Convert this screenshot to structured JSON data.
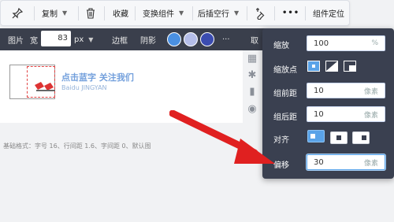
{
  "toolbar": {
    "copy_label": "复制",
    "favorite_label": "收藏",
    "transform_label": "变换组件",
    "insert_label": "后插空行",
    "more_label": "•••",
    "locate_label": "组件定位"
  },
  "image_bar": {
    "image_label": "图片",
    "width_label": "宽",
    "width_value": "83",
    "width_unit": "px",
    "border_label": "边框",
    "shadow_label": "阴影",
    "more_label": "···",
    "cancel_label": "取",
    "colors": [
      "#4a90e2",
      "#b4bde8",
      "#3b4cb0"
    ]
  },
  "canvas": {
    "watermark_line1": "点击蓝字 关注我们",
    "watermark_line2": "Baidu JINGYAN",
    "caption": "基础格式：字号 16、行间距 1.6、字间距 0、默认图"
  },
  "panel": {
    "scale_label": "缩放",
    "scale_value": "100",
    "scale_unit": "%",
    "anchor_label": "缩放点",
    "margin_top_label": "组前距",
    "margin_top_value": "10",
    "margin_top_unit": "像素",
    "margin_bottom_label": "组后距",
    "margin_bottom_value": "10",
    "margin_bottom_unit": "像素",
    "align_label": "对齐",
    "offset_label": "偏移",
    "offset_value": "30",
    "offset_unit": "像素"
  },
  "accent_colors": {
    "arrow": "#e02020",
    "active": "#5aa3e8"
  }
}
